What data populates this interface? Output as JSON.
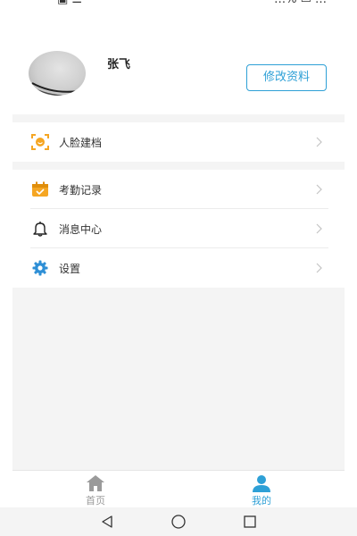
{
  "status": {
    "left": "▣ ☰",
    "right": "…% ▭ …"
  },
  "profile": {
    "name": "张飞",
    "edit_label": "修改资料"
  },
  "menu": {
    "group1": [
      {
        "label": "人脸建档",
        "icon": "face-scan-icon"
      }
    ],
    "group2": [
      {
        "label": "考勤记录",
        "icon": "calendar-check-icon"
      },
      {
        "label": "消息中心",
        "icon": "bell-icon"
      },
      {
        "label": "设置",
        "icon": "gear-icon"
      }
    ]
  },
  "tabbar": {
    "tabs": [
      {
        "label": "首页",
        "icon": "home-icon",
        "active": false
      },
      {
        "label": "我的",
        "icon": "user-icon",
        "active": true
      }
    ]
  },
  "colors": {
    "accent": "#2ea0d6",
    "icon_orange": "#f5a623",
    "inactive": "#9a9a9a",
    "background": "#f4f4f4"
  }
}
